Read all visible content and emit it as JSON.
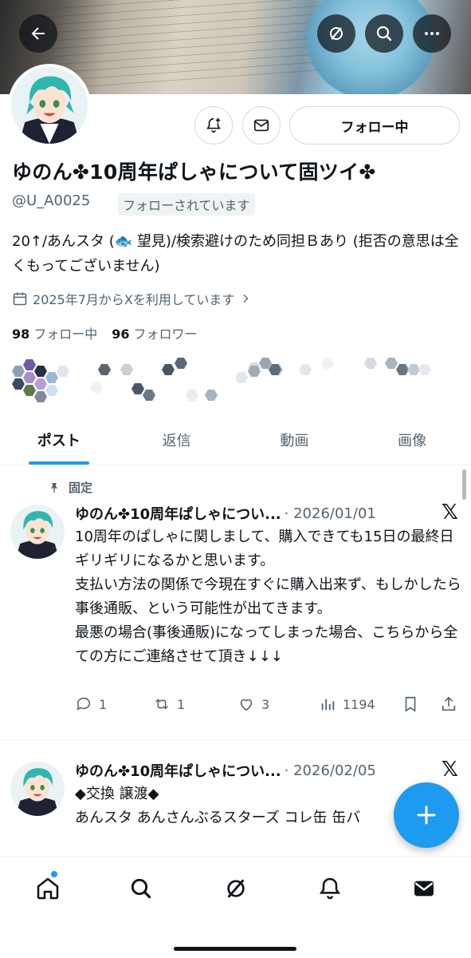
{
  "header": {
    "back_icon": "arrow-left-icon",
    "grok_icon": "grok-icon",
    "search_icon": "search-icon",
    "more_icon": "more-horizontal-icon"
  },
  "profile": {
    "display_name": "ゆのん✤10周年ぱしゃについて固ツイ✤",
    "handle": "@U_A0025",
    "follows_you": "フォローされています",
    "follow_button": "フォロー中",
    "bio": "20↑/あんスタ (🐟 望見)/検索避けのため同担Ｂあり (拒否の意思は全くもってございません)",
    "joined": "2025年7月からXを利用しています",
    "following_count": "98",
    "following_label": "フォロー中",
    "followers_count": "96",
    "followers_label": "フォロワー"
  },
  "tabs": [
    "ポスト",
    "返信",
    "動画",
    "画像"
  ],
  "active_tab": "ポスト",
  "pinned_label": "固定",
  "tweets": [
    {
      "name": "ゆのん✤10周年ぱしゃについ...",
      "date": "· 2026/01/01",
      "text": "10周年のぱしゃに関しまして、購入できても15日の最終日ギリギリになるかと思います。\n支払い方法の関係で今現在すぐに購入出来ず、もしかしたら事後通販、という可能性が出てきます。\n最悪の場合(事後通販)になってしまった場合、こちらから全ての方にご連絡させて頂き↓↓↓",
      "replies": "1",
      "reposts": "1",
      "likes": "3",
      "views": "1194"
    },
    {
      "name": "ゆのん✤10周年ぱしゃについ...",
      "date": "· 2026/02/05",
      "text": "◆交換 譲渡◆\nあんスタ あんさんぶるスターズ コレ缶 缶バ"
    }
  ],
  "colors": {
    "accent": "#1d9bf0",
    "text_primary": "#0f1419",
    "text_secondary": "#536471"
  }
}
